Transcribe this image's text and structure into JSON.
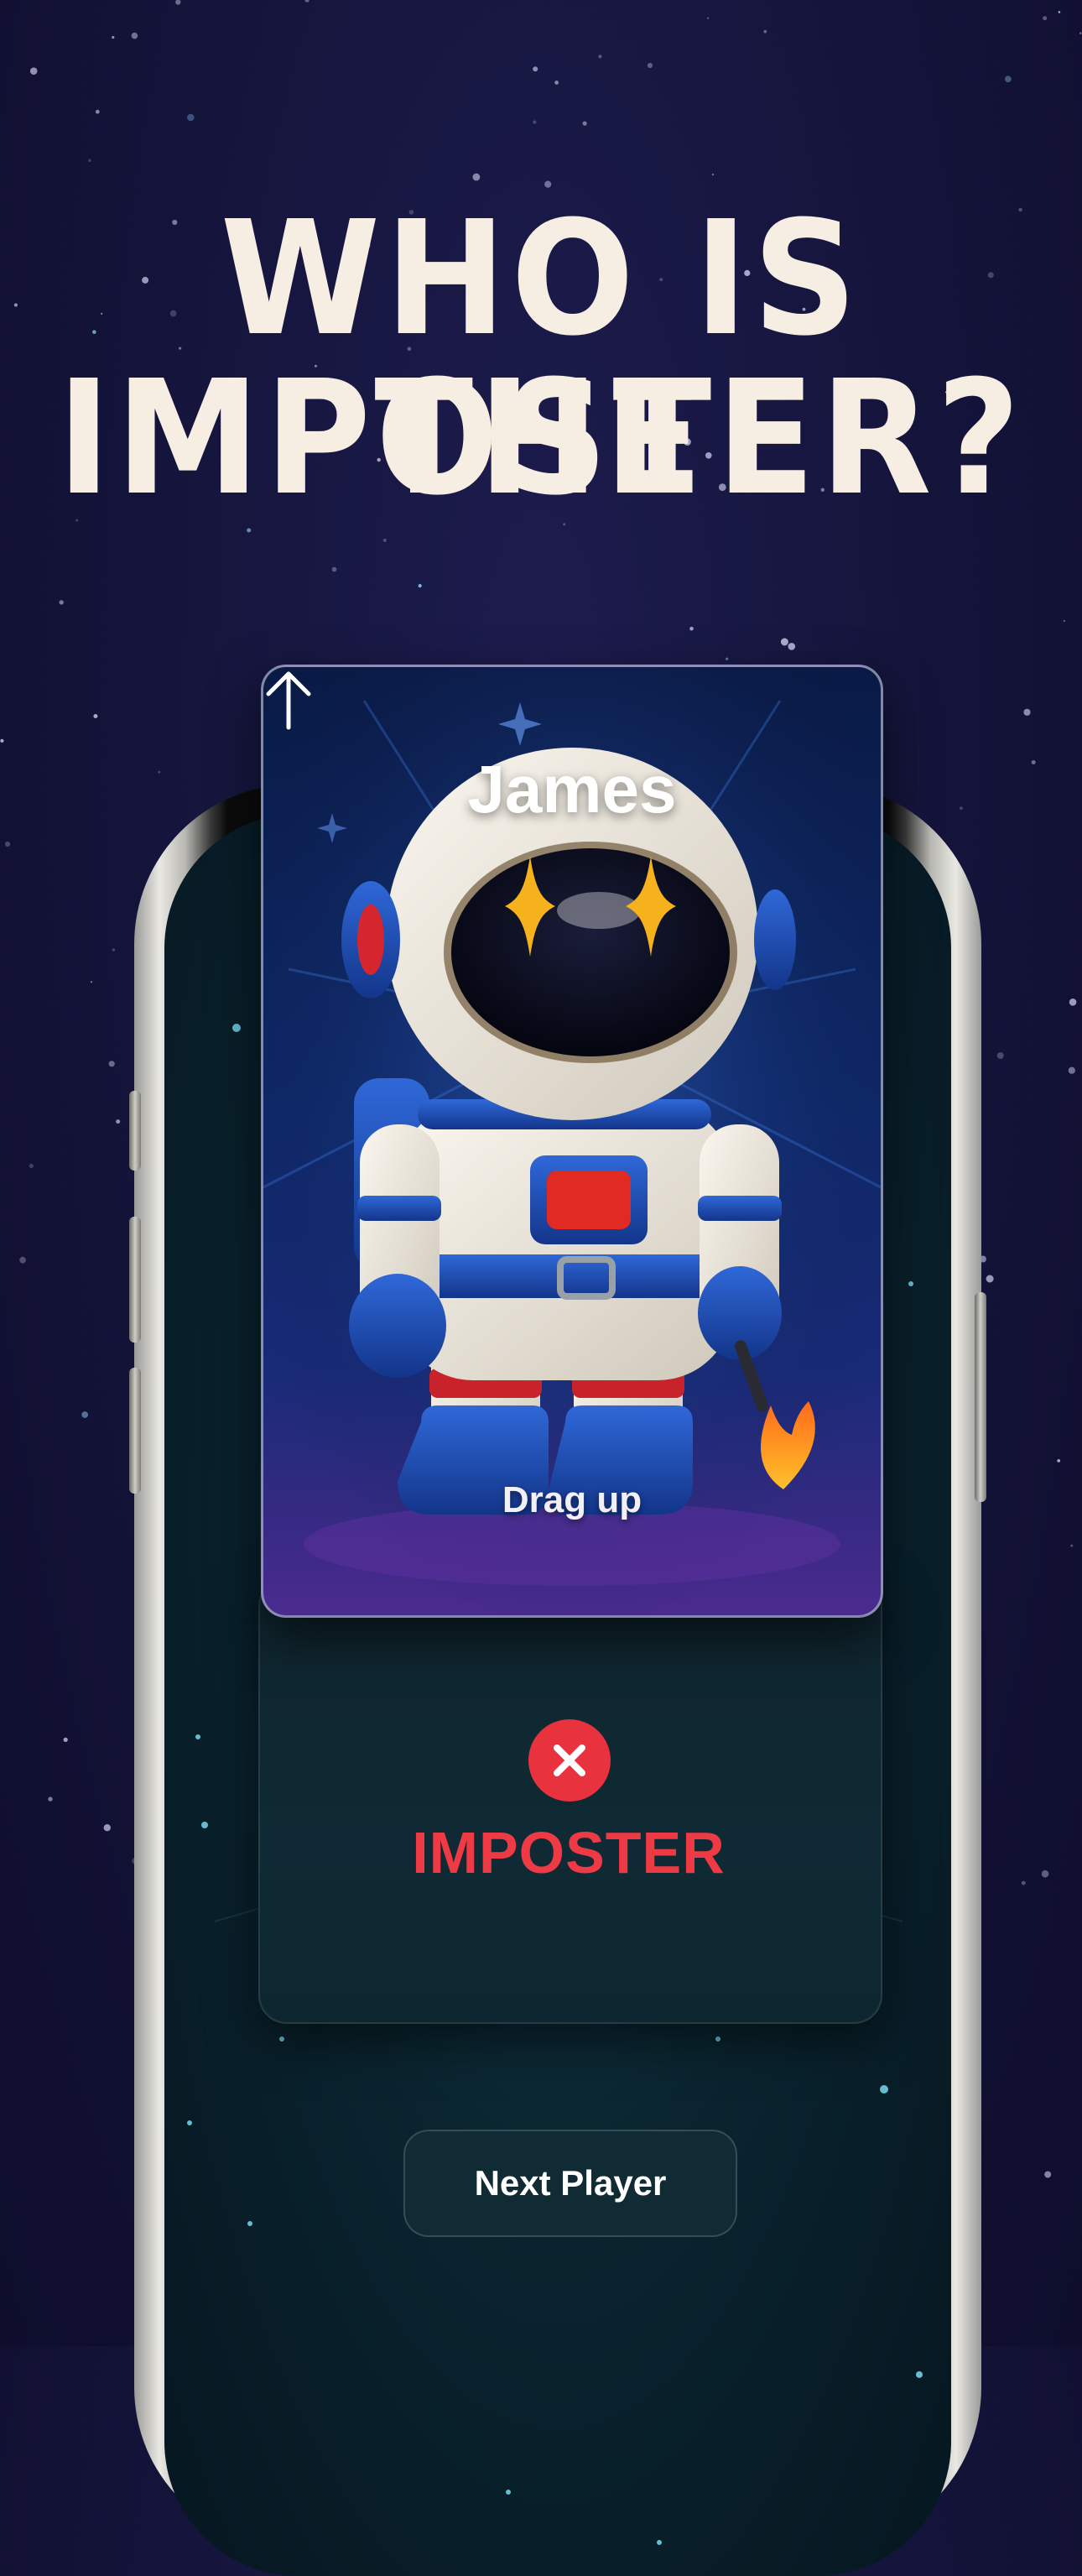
{
  "headline": {
    "line1": "WHO IS THE",
    "line2": "IMPOSTER?"
  },
  "card": {
    "player_name": "James",
    "drag_hint": "Drag up",
    "avatar": "astronaut-illustration"
  },
  "reveal": {
    "role_label": "IMPOSTER",
    "role_icon": "close-icon",
    "role_color": "#ee3a45"
  },
  "actions": {
    "next_player_label": "Next Player"
  },
  "colors": {
    "background": "#15153d",
    "headline": "#f6eee3",
    "accent_red": "#e8333f",
    "screen": "#0a2530"
  }
}
